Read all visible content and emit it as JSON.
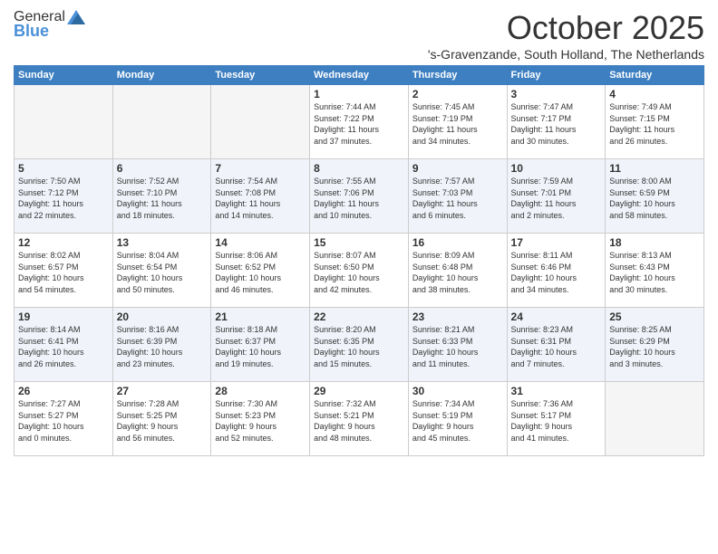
{
  "logo": {
    "general": "General",
    "blue": "Blue"
  },
  "header": {
    "month": "October 2025",
    "location": "'s-Gravenzande, South Holland, The Netherlands"
  },
  "weekdays": [
    "Sunday",
    "Monday",
    "Tuesday",
    "Wednesday",
    "Thursday",
    "Friday",
    "Saturday"
  ],
  "weeks": [
    [
      {
        "day": "",
        "info": ""
      },
      {
        "day": "",
        "info": ""
      },
      {
        "day": "",
        "info": ""
      },
      {
        "day": "1",
        "info": "Sunrise: 7:44 AM\nSunset: 7:22 PM\nDaylight: 11 hours\nand 37 minutes."
      },
      {
        "day": "2",
        "info": "Sunrise: 7:45 AM\nSunset: 7:19 PM\nDaylight: 11 hours\nand 34 minutes."
      },
      {
        "day": "3",
        "info": "Sunrise: 7:47 AM\nSunset: 7:17 PM\nDaylight: 11 hours\nand 30 minutes."
      },
      {
        "day": "4",
        "info": "Sunrise: 7:49 AM\nSunset: 7:15 PM\nDaylight: 11 hours\nand 26 minutes."
      }
    ],
    [
      {
        "day": "5",
        "info": "Sunrise: 7:50 AM\nSunset: 7:12 PM\nDaylight: 11 hours\nand 22 minutes."
      },
      {
        "day": "6",
        "info": "Sunrise: 7:52 AM\nSunset: 7:10 PM\nDaylight: 11 hours\nand 18 minutes."
      },
      {
        "day": "7",
        "info": "Sunrise: 7:54 AM\nSunset: 7:08 PM\nDaylight: 11 hours\nand 14 minutes."
      },
      {
        "day": "8",
        "info": "Sunrise: 7:55 AM\nSunset: 7:06 PM\nDaylight: 11 hours\nand 10 minutes."
      },
      {
        "day": "9",
        "info": "Sunrise: 7:57 AM\nSunset: 7:03 PM\nDaylight: 11 hours\nand 6 minutes."
      },
      {
        "day": "10",
        "info": "Sunrise: 7:59 AM\nSunset: 7:01 PM\nDaylight: 11 hours\nand 2 minutes."
      },
      {
        "day": "11",
        "info": "Sunrise: 8:00 AM\nSunset: 6:59 PM\nDaylight: 10 hours\nand 58 minutes."
      }
    ],
    [
      {
        "day": "12",
        "info": "Sunrise: 8:02 AM\nSunset: 6:57 PM\nDaylight: 10 hours\nand 54 minutes."
      },
      {
        "day": "13",
        "info": "Sunrise: 8:04 AM\nSunset: 6:54 PM\nDaylight: 10 hours\nand 50 minutes."
      },
      {
        "day": "14",
        "info": "Sunrise: 8:06 AM\nSunset: 6:52 PM\nDaylight: 10 hours\nand 46 minutes."
      },
      {
        "day": "15",
        "info": "Sunrise: 8:07 AM\nSunset: 6:50 PM\nDaylight: 10 hours\nand 42 minutes."
      },
      {
        "day": "16",
        "info": "Sunrise: 8:09 AM\nSunset: 6:48 PM\nDaylight: 10 hours\nand 38 minutes."
      },
      {
        "day": "17",
        "info": "Sunrise: 8:11 AM\nSunset: 6:46 PM\nDaylight: 10 hours\nand 34 minutes."
      },
      {
        "day": "18",
        "info": "Sunrise: 8:13 AM\nSunset: 6:43 PM\nDaylight: 10 hours\nand 30 minutes."
      }
    ],
    [
      {
        "day": "19",
        "info": "Sunrise: 8:14 AM\nSunset: 6:41 PM\nDaylight: 10 hours\nand 26 minutes."
      },
      {
        "day": "20",
        "info": "Sunrise: 8:16 AM\nSunset: 6:39 PM\nDaylight: 10 hours\nand 23 minutes."
      },
      {
        "day": "21",
        "info": "Sunrise: 8:18 AM\nSunset: 6:37 PM\nDaylight: 10 hours\nand 19 minutes."
      },
      {
        "day": "22",
        "info": "Sunrise: 8:20 AM\nSunset: 6:35 PM\nDaylight: 10 hours\nand 15 minutes."
      },
      {
        "day": "23",
        "info": "Sunrise: 8:21 AM\nSunset: 6:33 PM\nDaylight: 10 hours\nand 11 minutes."
      },
      {
        "day": "24",
        "info": "Sunrise: 8:23 AM\nSunset: 6:31 PM\nDaylight: 10 hours\nand 7 minutes."
      },
      {
        "day": "25",
        "info": "Sunrise: 8:25 AM\nSunset: 6:29 PM\nDaylight: 10 hours\nand 3 minutes."
      }
    ],
    [
      {
        "day": "26",
        "info": "Sunrise: 7:27 AM\nSunset: 5:27 PM\nDaylight: 10 hours\nand 0 minutes."
      },
      {
        "day": "27",
        "info": "Sunrise: 7:28 AM\nSunset: 5:25 PM\nDaylight: 9 hours\nand 56 minutes."
      },
      {
        "day": "28",
        "info": "Sunrise: 7:30 AM\nSunset: 5:23 PM\nDaylight: 9 hours\nand 52 minutes."
      },
      {
        "day": "29",
        "info": "Sunrise: 7:32 AM\nSunset: 5:21 PM\nDaylight: 9 hours\nand 48 minutes."
      },
      {
        "day": "30",
        "info": "Sunrise: 7:34 AM\nSunset: 5:19 PM\nDaylight: 9 hours\nand 45 minutes."
      },
      {
        "day": "31",
        "info": "Sunrise: 7:36 AM\nSunset: 5:17 PM\nDaylight: 9 hours\nand 41 minutes."
      },
      {
        "day": "",
        "info": ""
      }
    ]
  ]
}
